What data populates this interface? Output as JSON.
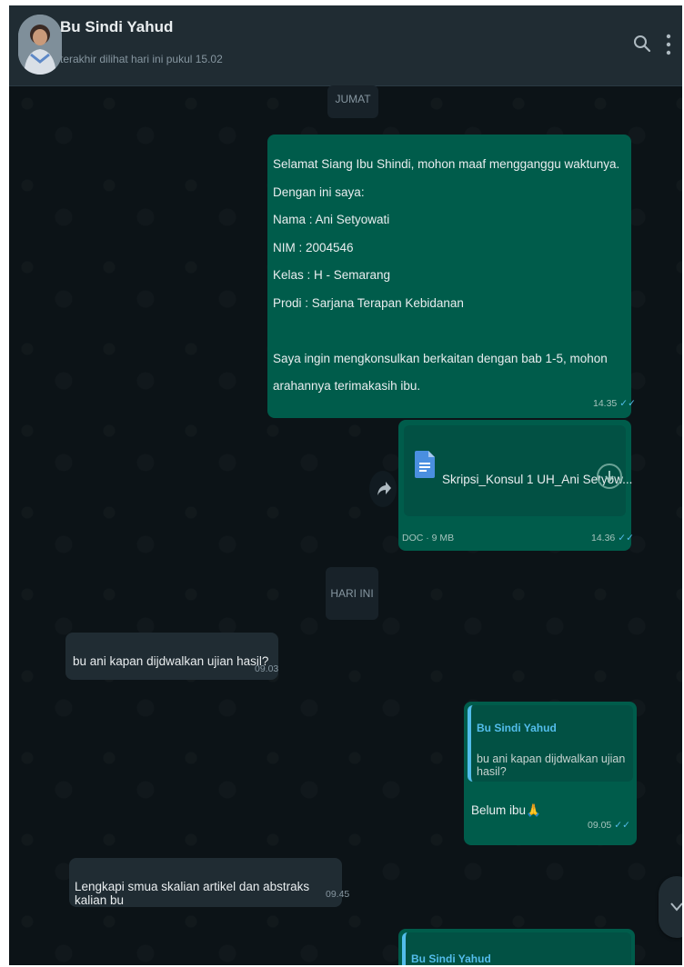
{
  "header": {
    "contact_name": "Bu Sindi Yahud",
    "last_seen": "terakhir dilihat hari ini pukul 15.02",
    "search_icon": "search-icon",
    "menu_icon": "kebab-menu-icon"
  },
  "date_chips": {
    "older": "JUMAT",
    "today": "HARI INI"
  },
  "messages": [
    {
      "direction": "outgoing",
      "text": "Selamat Siang Ibu Shindi, mohon maaf mengganggu waktunya.\nDengan ini saya:\nNama : Ani Setyowati\nNIM : 2004546\nKelas : H - Semarang\nProdi : Sarjana Terapan Kebidanan\n\nSaya ingin mengkonsulkan berkaitan dengan bab 1-5, mohon arahannya terimakasih ibu.",
      "time": "14.35",
      "status": "read"
    },
    {
      "direction": "outgoing",
      "type": "document",
      "file_name": "Skripsi_Konsul 1 UH_Ani Setyow...",
      "file_info": "DOC · 9 MB",
      "time": "14.36",
      "status": "read"
    },
    {
      "direction": "incoming",
      "text": "bu ani kapan dijdwalkan ujian hasil?",
      "time": "09.03"
    },
    {
      "direction": "outgoing",
      "quoted_author": "Bu Sindi Yahud",
      "quoted_text": "bu ani kapan dijdwalkan ujian hasil?",
      "text": "Belum ibu🙏",
      "time": "09.05",
      "status": "read"
    },
    {
      "direction": "incoming",
      "text": "Lengkapi smua skalian artikel dan abstraks kalian bu",
      "time": "09.45"
    },
    {
      "direction": "outgoing",
      "quoted_author": "Bu Sindi Yahud"
    }
  ],
  "read_ticks": "✓✓",
  "colors": {
    "header_bg": "#202c33",
    "chat_bg": "#0c1317",
    "outgoing_bubble": "#005c4b",
    "incoming_bubble": "#202c33",
    "accent_blue": "#53bdeb"
  }
}
